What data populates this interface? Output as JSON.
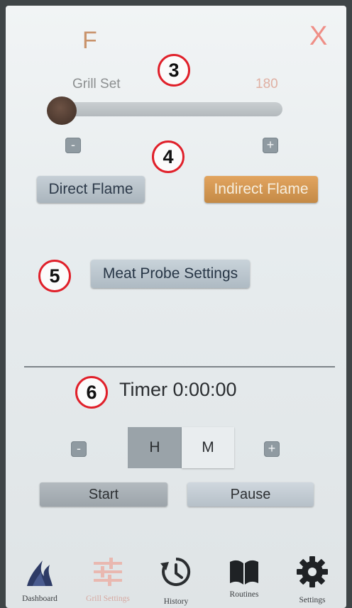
{
  "header": {
    "unit": "F",
    "close": "X"
  },
  "annotations": [
    "3",
    "4",
    "5",
    "6"
  ],
  "grill": {
    "label": "Grill Set",
    "value": "180",
    "slider_level": 0.0
  },
  "adjust": {
    "minus": "-",
    "plus": "+"
  },
  "modes": {
    "direct": "Direct Flame",
    "indirect": "Indirect Flame",
    "selected": "Indirect Flame"
  },
  "probe": {
    "label": "Meat Probe Settings"
  },
  "timer": {
    "label": "Timer 0:00:00",
    "minus": "-",
    "plus": "+",
    "hours": "H",
    "minutes": "M",
    "start": "Start",
    "pause": "Pause"
  },
  "nav": {
    "items": [
      {
        "label": "Dashboard",
        "icon": "flame-icon"
      },
      {
        "label": "Grill Settings",
        "icon": "sliders-icon"
      },
      {
        "label": "History",
        "icon": "history-icon"
      },
      {
        "label": "Routines",
        "icon": "book-icon"
      },
      {
        "label": "Settings",
        "icon": "gear-icon"
      }
    ]
  },
  "colors": {
    "accent": "#d99a55",
    "unit": "#c9936b",
    "close": "#ef8e86",
    "annotation_ring": "#e0202a"
  }
}
